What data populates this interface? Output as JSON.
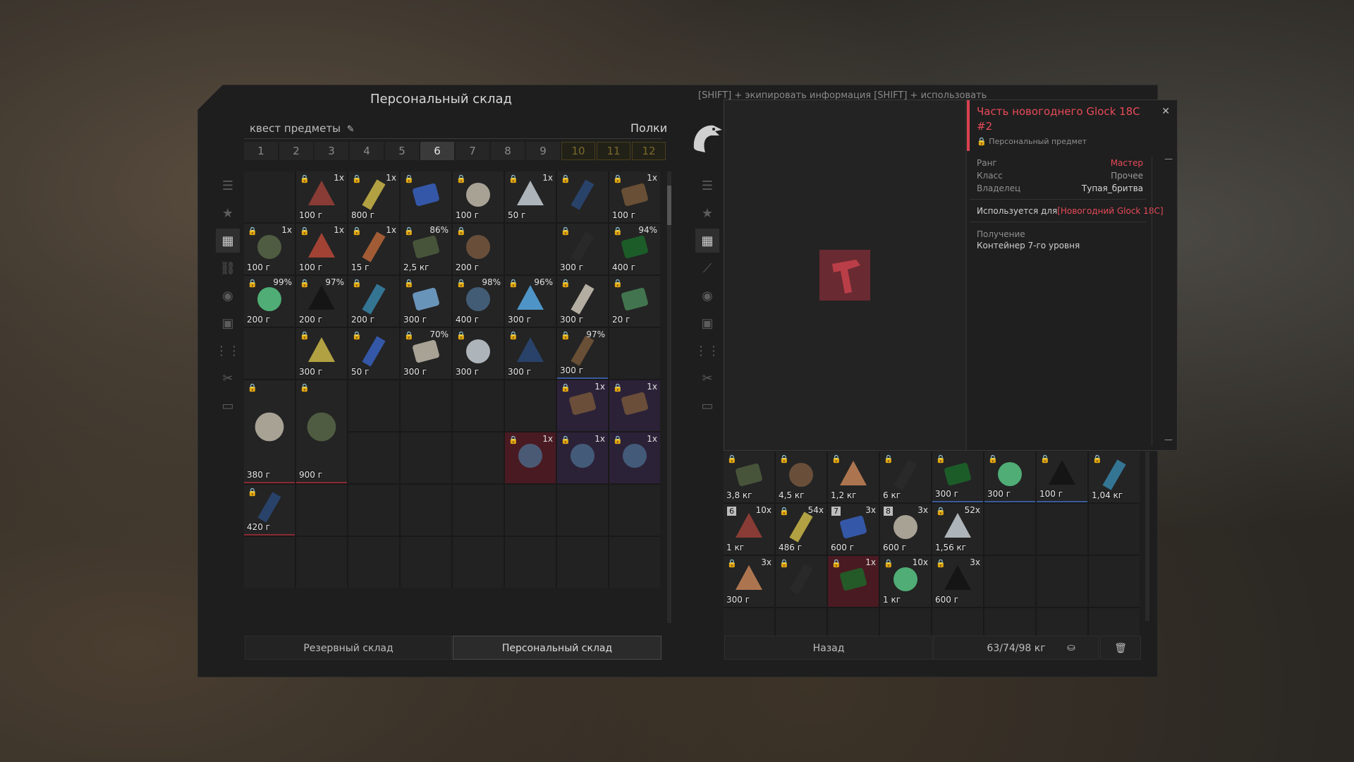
{
  "left_panel": {
    "title": "Персональный склад",
    "quest_label": "квест предметы",
    "shelves_label": "Полки",
    "tabs": [
      "1",
      "2",
      "3",
      "4",
      "5",
      "6",
      "7",
      "8",
      "9",
      "10",
      "11",
      "12"
    ],
    "active_tab": "6",
    "nav_icons": [
      "list-icon",
      "star-icon",
      "grid-icon",
      "link-icon",
      "sphere-icon",
      "camera-icon",
      "ammo-icon",
      "tools-icon",
      "box-icon"
    ],
    "rows": [
      [
        {
          "w": ""
        },
        {
          "w": "100 г",
          "q": "1x"
        },
        {
          "w": "800 г",
          "q": "1x"
        },
        {
          "w": ""
        },
        {
          "w": "100 г",
          "q": ""
        },
        {
          "w": "50 г",
          "q": "1x"
        },
        {
          "w": ""
        },
        {
          "w": "100 г",
          "q": "1x"
        }
      ],
      [
        {
          "w": "100 г",
          "q": "1x"
        },
        {
          "w": "100 г",
          "q": "1x"
        },
        {
          "w": "15 г",
          "q": "1x"
        },
        {
          "w": "2,5 кг",
          "q": "86%"
        },
        {
          "w": "200 г"
        },
        {
          "w": ""
        },
        {
          "w": "300 г"
        },
        {
          "w": "400 г",
          "q": "94%"
        }
      ],
      [
        {
          "w": "200 г",
          "q": "99%"
        },
        {
          "w": "200 г",
          "q": "97%"
        },
        {
          "w": "200 г"
        },
        {
          "w": "300 г"
        },
        {
          "w": "400 г",
          "q": "98%"
        },
        {
          "w": "300 г",
          "q": "96%"
        },
        {
          "w": "300 г"
        },
        {
          "w": "20 г"
        }
      ],
      [
        {
          "w": ""
        },
        {
          "w": "300 г"
        },
        {
          "w": "50 г"
        },
        {
          "w": "300 г",
          "q": "70%"
        },
        {
          "w": "300 г"
        },
        {
          "w": "300 г"
        },
        {
          "w": "300 г",
          "q": "97%"
        },
        {
          "w": ""
        }
      ]
    ],
    "row5": {
      "mag_weight": "380 г",
      "ball_weight": "900 г",
      "glock_qty": "1x"
    },
    "row7": {
      "weight": "420 г"
    },
    "bottom_tabs": [
      "Резервный склад",
      "Персональный склад"
    ]
  },
  "right_panel": {
    "hints": "[SHIFT] +    экипировать       информация    [SHIFT] +    использовать",
    "nav_icons": [
      "list-icon",
      "star-icon",
      "grid-icon",
      "rifle-icon",
      "sphere-icon",
      "camera-icon",
      "ammo-icon",
      "tools-icon",
      "box-icon"
    ],
    "row1": [
      {
        "w": "3,8 кг"
      },
      {
        "w": "4,5 кг"
      },
      {
        "w": "1,2 кг"
      },
      {
        "w": "6 кг"
      },
      {
        "w": "300 г"
      },
      {
        "w": "300 г"
      },
      {
        "w": "100 г"
      },
      {
        "w": "1,04 кг"
      }
    ],
    "row2": [
      {
        "w": "1 кг",
        "q": "10x",
        "n": "6"
      },
      {
        "w": "486 г",
        "q": "54x"
      },
      {
        "w": "600 г",
        "q": "3x",
        "n": "7"
      },
      {
        "w": "600 г",
        "q": "3x",
        "n": "8"
      },
      {
        "w": "1,56 кг",
        "q": "52x"
      },
      {
        "w": ""
      },
      {
        "w": ""
      },
      {
        "w": ""
      }
    ],
    "row3": [
      {
        "w": "300 г",
        "q": "3x"
      },
      {
        "w": ""
      },
      {
        "w": "",
        "q": "1x"
      },
      {
        "w": "1 кг",
        "q": "10x"
      },
      {
        "w": "600 г",
        "q": "3x"
      },
      {
        "w": ""
      },
      {
        "w": ""
      },
      {
        "w": ""
      }
    ],
    "back_label": "Назад",
    "weight_label": "63/74/98 кг"
  },
  "popup": {
    "title": "Часть новогоднего Glock 18C #2",
    "subtitle": "Персональный предмет",
    "rank_label": "Ранг",
    "rank_value": "Мастер",
    "class_label": "Класс",
    "class_value": "Прочее",
    "owner_label": "Владелец",
    "owner_value": "Тупая_бритва",
    "used_for_prefix": "Используется для",
    "used_for_item": "[Новогодний Glock 18C]",
    "obtain_label": "Получение",
    "obtain_value": "Контейнер 7-го уровня"
  },
  "colors": {
    "accent_red": "#e84a58",
    "purple_cell": "#2c2238",
    "panel": "#1e1e1e"
  }
}
